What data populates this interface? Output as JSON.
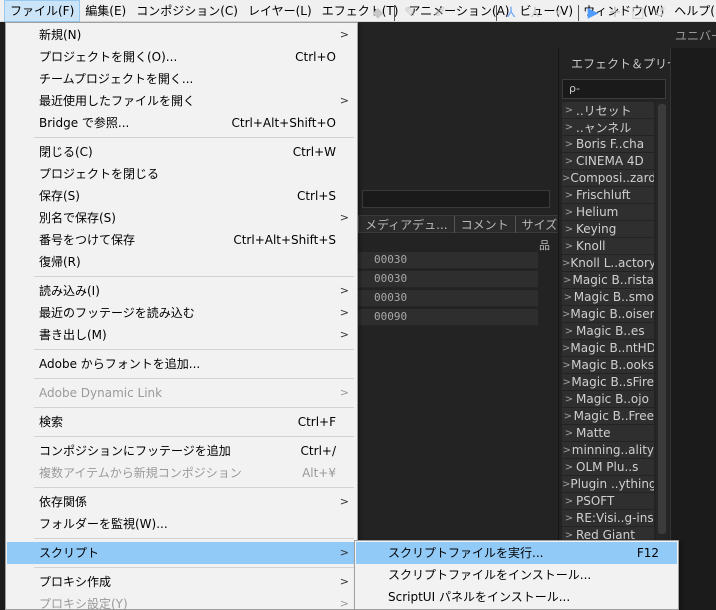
{
  "menubar": {
    "items": [
      "ファイル(F)",
      "編集(E)",
      "コンポジション(C)",
      "レイヤー(L)",
      "エフェクト(T)",
      "アニメーション(A)",
      "ビュー(V)",
      "ウィンドウ(W)",
      "ヘルプ(H)"
    ]
  },
  "toolbar": {
    "label": "ユニバー"
  },
  "file_menu": {
    "items": [
      {
        "label": "新規(N)",
        "shortcut": "",
        "submenu": true,
        "disabled": false
      },
      {
        "label": "プロジェクトを開く(O)...",
        "shortcut": "Ctrl+O",
        "submenu": false,
        "disabled": false
      },
      {
        "label": "チームプロジェクトを開く...",
        "shortcut": "",
        "submenu": false,
        "disabled": false
      },
      {
        "label": "最近使用したファイルを開く",
        "shortcut": "",
        "submenu": true,
        "disabled": false
      },
      {
        "label": "Bridge で参照...",
        "shortcut": "Ctrl+Alt+Shift+O",
        "submenu": false,
        "disabled": false
      },
      {
        "label": "閉じる(C)",
        "shortcut": "Ctrl+W",
        "submenu": false,
        "disabled": false
      },
      {
        "label": "プロジェクトを閉じる",
        "shortcut": "",
        "submenu": false,
        "disabled": false
      },
      {
        "label": "保存(S)",
        "shortcut": "Ctrl+S",
        "submenu": false,
        "disabled": false
      },
      {
        "label": "別名で保存(S)",
        "shortcut": "",
        "submenu": true,
        "disabled": false
      },
      {
        "label": "番号をつけて保存",
        "shortcut": "Ctrl+Alt+Shift+S",
        "submenu": false,
        "disabled": false
      },
      {
        "label": "復帰(R)",
        "shortcut": "",
        "submenu": false,
        "disabled": false
      },
      {
        "label": "読み込み(I)",
        "shortcut": "",
        "submenu": true,
        "disabled": false
      },
      {
        "label": "最近のフッテージを読み込む",
        "shortcut": "",
        "submenu": true,
        "disabled": false
      },
      {
        "label": "書き出し(M)",
        "shortcut": "",
        "submenu": true,
        "disabled": false
      },
      {
        "label": "Adobe からフォントを追加...",
        "shortcut": "",
        "submenu": false,
        "disabled": false
      },
      {
        "label": "Adobe Dynamic Link",
        "shortcut": "",
        "submenu": true,
        "disabled": true
      },
      {
        "label": "検索",
        "shortcut": "Ctrl+F",
        "submenu": false,
        "disabled": false
      },
      {
        "label": "コンポジションにフッテージを追加",
        "shortcut": "Ctrl+/",
        "submenu": false,
        "disabled": false
      },
      {
        "label": "複数アイテムから新規コンポジション",
        "shortcut": "Alt+¥",
        "submenu": false,
        "disabled": true
      },
      {
        "label": "依存関係",
        "shortcut": "",
        "submenu": true,
        "disabled": false
      },
      {
        "label": "フォルダーを監視(W)...",
        "shortcut": "",
        "submenu": false,
        "disabled": false
      },
      {
        "label": "スクリプト",
        "shortcut": "",
        "submenu": true,
        "disabled": false,
        "highlighted": true
      },
      {
        "label": "プロキシ作成",
        "shortcut": "",
        "submenu": true,
        "disabled": false
      },
      {
        "label": "プロキシ設定(Y)",
        "shortcut": "",
        "submenu": true,
        "disabled": true
      }
    ]
  },
  "script_submenu": {
    "items": [
      {
        "label": "スクリプトファイルを実行...",
        "shortcut": "F12",
        "highlighted": true
      },
      {
        "label": "スクリプトファイルをインストール...",
        "shortcut": ""
      },
      {
        "label": "ScriptUI パネルをインストール...",
        "shortcut": ""
      }
    ]
  },
  "project_panel": {
    "columns": [
      "メディアデュ...",
      "コメント",
      "サイズ"
    ],
    "rows": [
      "00030",
      "00030",
      "00030",
      "00090"
    ]
  },
  "effects_panel": {
    "title": "エフェクト＆プリセ",
    "search_placeholder": "ρ-",
    "items": [
      "..リセット",
      "..ャンネル",
      "Boris F..cha",
      "CINEMA 4D",
      "Composi..zard",
      "Frischluft",
      "Helium",
      "Keying",
      "Knoll",
      "Knoll L..actory",
      "Magic B..rista",
      "Magic B..smo",
      "Magic B..oiser",
      "Magic B..es",
      "Magic B..ntHD",
      "Magic B..ooks",
      "Magic B..sFire",
      "Magic B..ojo",
      "Magic B..Free",
      "Matte",
      "minning..ality",
      "OLM Plu..s",
      "Plugin ..ything",
      "PSOFT",
      "RE:Visi..g-ins",
      "Red Giant"
    ]
  }
}
